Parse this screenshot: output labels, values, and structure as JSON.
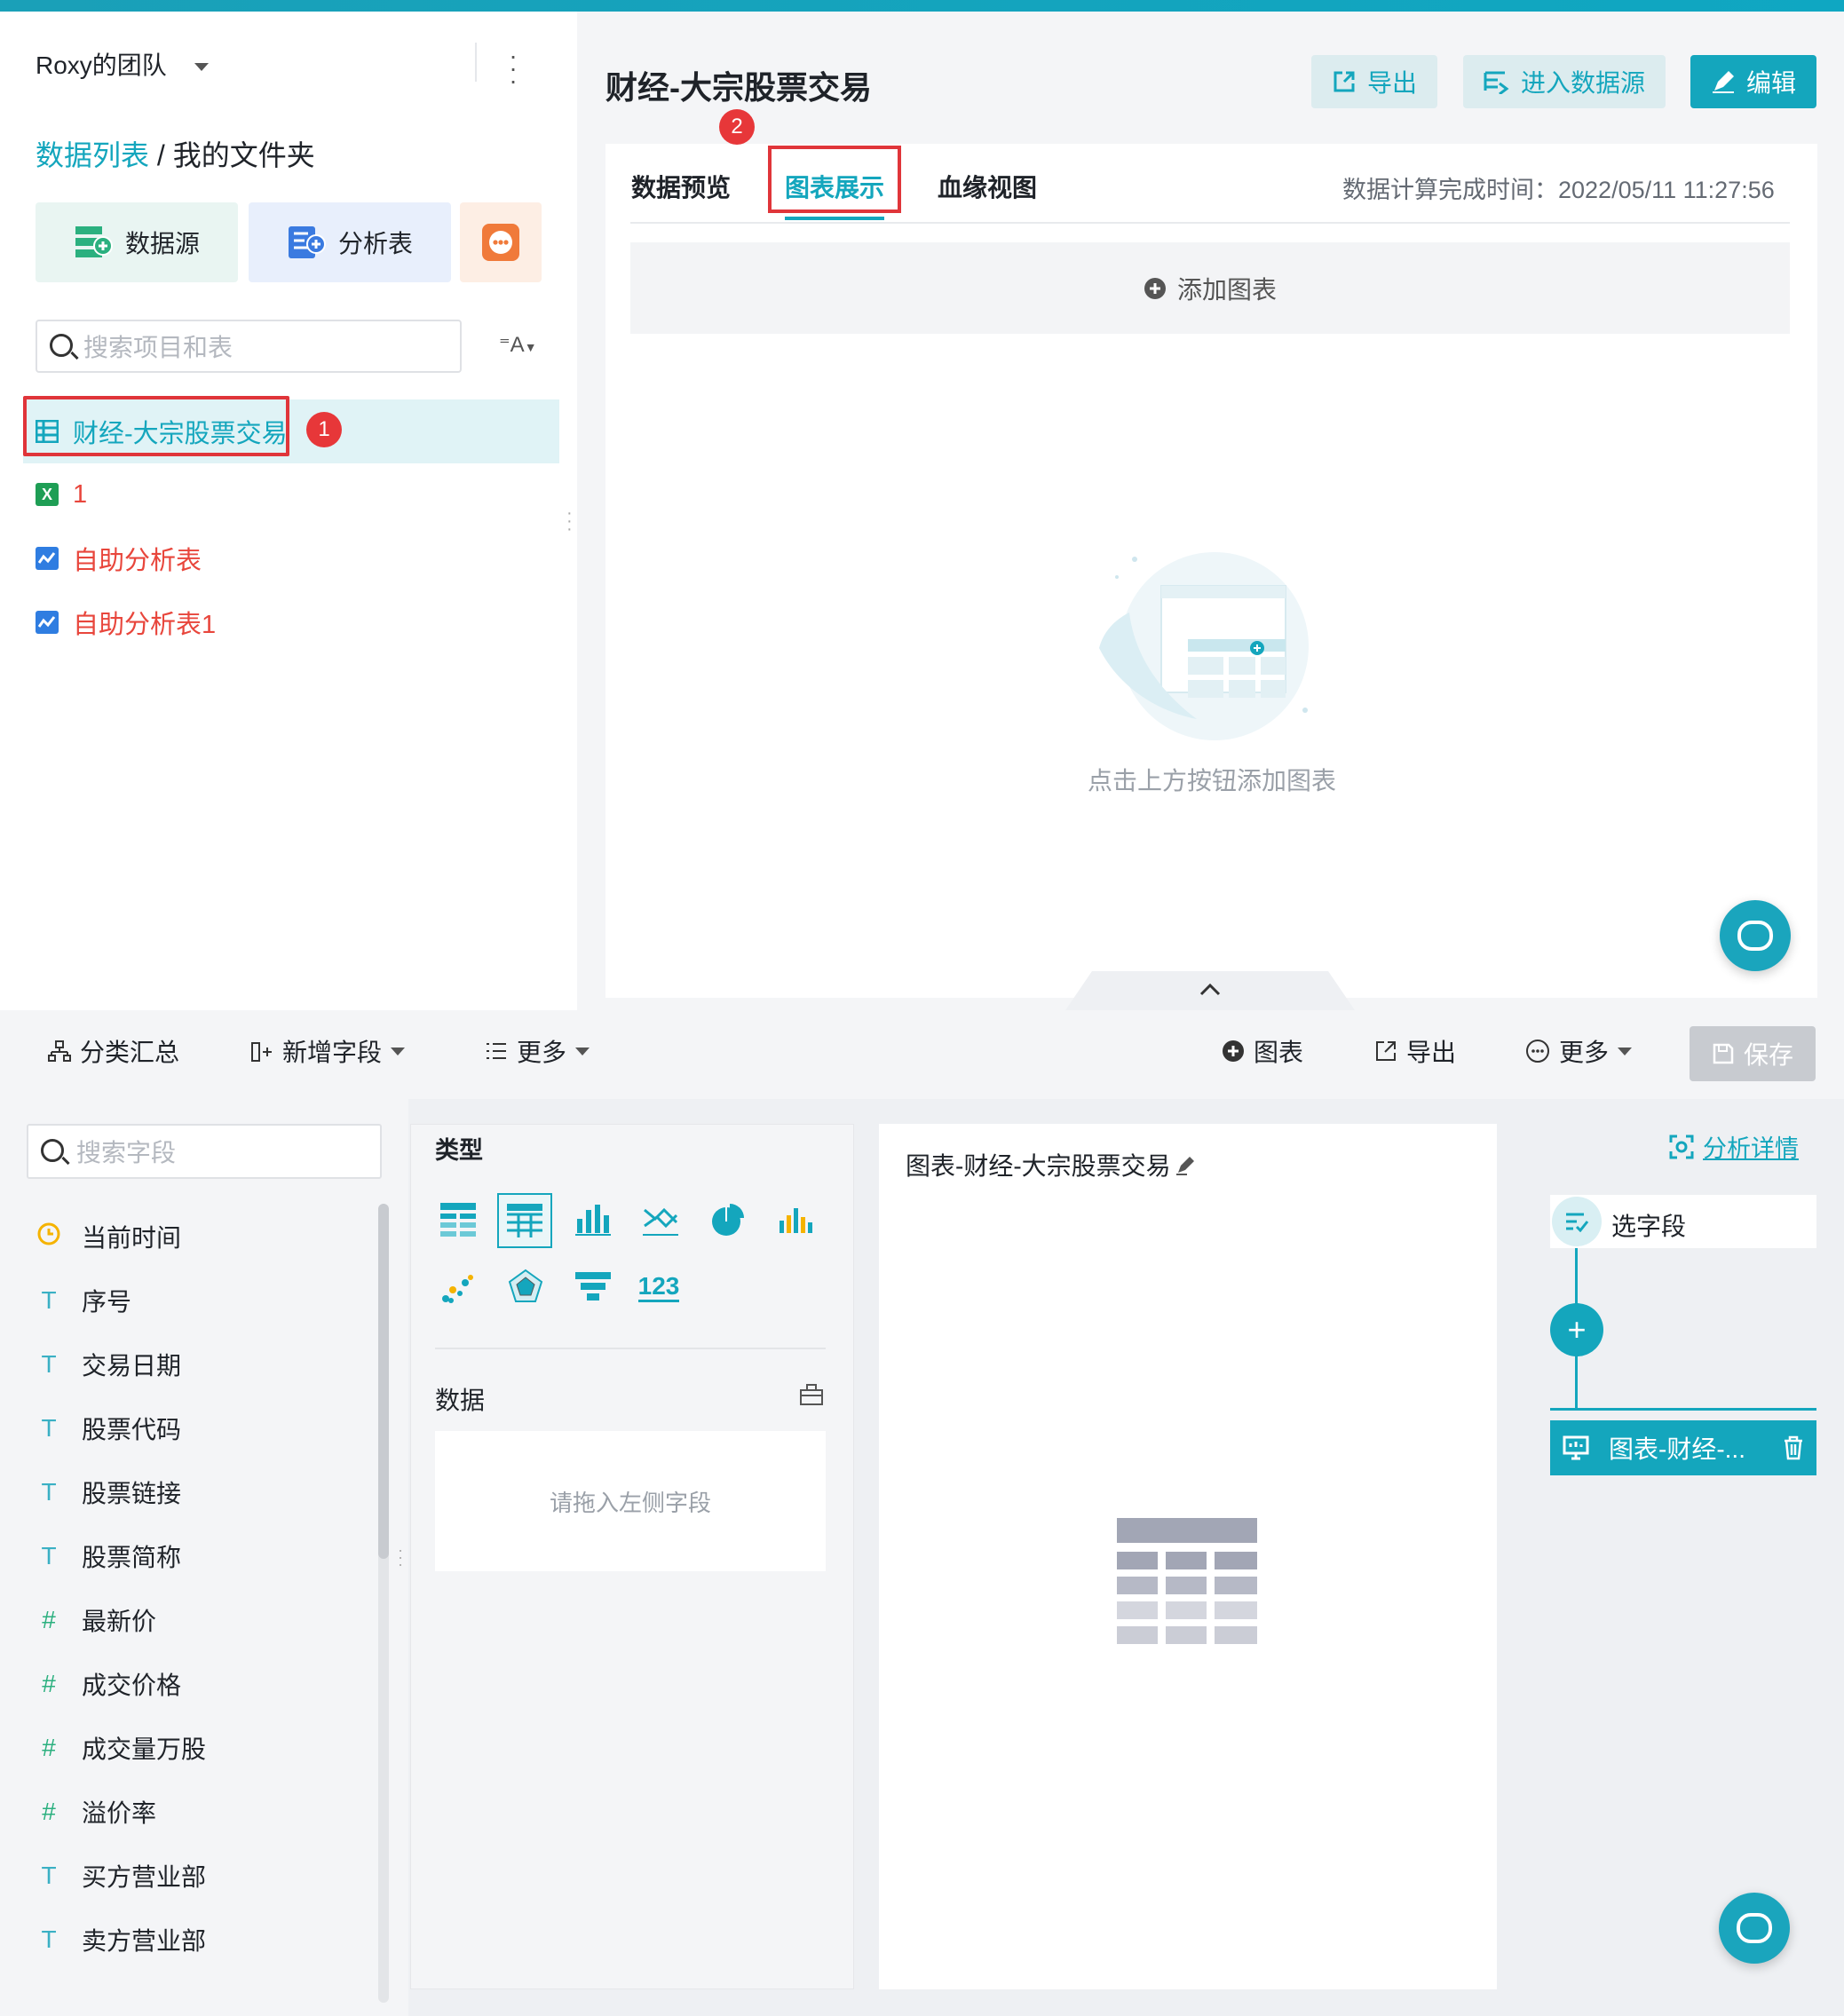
{
  "left": {
    "team": "Roxy的团队",
    "crumb_link": "数据列表",
    "crumb_sep": " / ",
    "crumb_current": "我的文件夹",
    "btn_datasource": "数据源",
    "btn_analysis": "分析表",
    "search_placeholder": "搜索项目和表",
    "items": [
      {
        "label": "财经-大宗股票交易",
        "color": "#14a6bd"
      },
      {
        "label": "1",
        "color": "#e8463c"
      },
      {
        "label": "自助分析表",
        "color": "#e8463c"
      },
      {
        "label": "自助分析表1",
        "color": "#e8463c"
      }
    ],
    "badge1": "1"
  },
  "right": {
    "title": "财经-大宗股票交易",
    "btn_export": "导出",
    "btn_enter_ds": "进入数据源",
    "btn_edit": "编辑",
    "tabs": [
      "数据预览",
      "图表展示",
      "血缘视图"
    ],
    "badge2": "2",
    "calc_time": "数据计算完成时间：2022/05/11 11:27:56",
    "add_chart": "添加图表",
    "empty_text": "点击上方按钮添加图表"
  },
  "toolbar": {
    "group_sum": "分类汇总",
    "add_field": "新增字段",
    "more1": "更多",
    "chart": "图表",
    "export": "导出",
    "more2": "更多",
    "save": "保存"
  },
  "fields": {
    "search_placeholder": "搜索字段",
    "items": [
      {
        "type": "clock",
        "label": "当前时间"
      },
      {
        "type": "T",
        "label": "序号"
      },
      {
        "type": "T",
        "label": "交易日期"
      },
      {
        "type": "T",
        "label": "股票代码"
      },
      {
        "type": "T",
        "label": "股票链接"
      },
      {
        "type": "T",
        "label": "股票简称"
      },
      {
        "type": "#",
        "label": "最新价"
      },
      {
        "type": "#",
        "label": "成交价格"
      },
      {
        "type": "#",
        "label": "成交量万股"
      },
      {
        "type": "#",
        "label": "溢价率"
      },
      {
        "type": "T",
        "label": "买方营业部"
      },
      {
        "type": "T",
        "label": "卖方营业部"
      }
    ]
  },
  "typepane": {
    "type_label": "类型",
    "data_label": "数据",
    "drop_hint": "请拖入左侧字段",
    "num_icon": "123"
  },
  "canvas": {
    "title": "图表-财经-大宗股票交易"
  },
  "flow": {
    "detail_link": "分析详情",
    "select_field": "选字段",
    "chart_node": "图表-财经-...",
    "plus": "+"
  },
  "colors": {
    "accent": "#14a6bd",
    "red": "#e0353a"
  }
}
